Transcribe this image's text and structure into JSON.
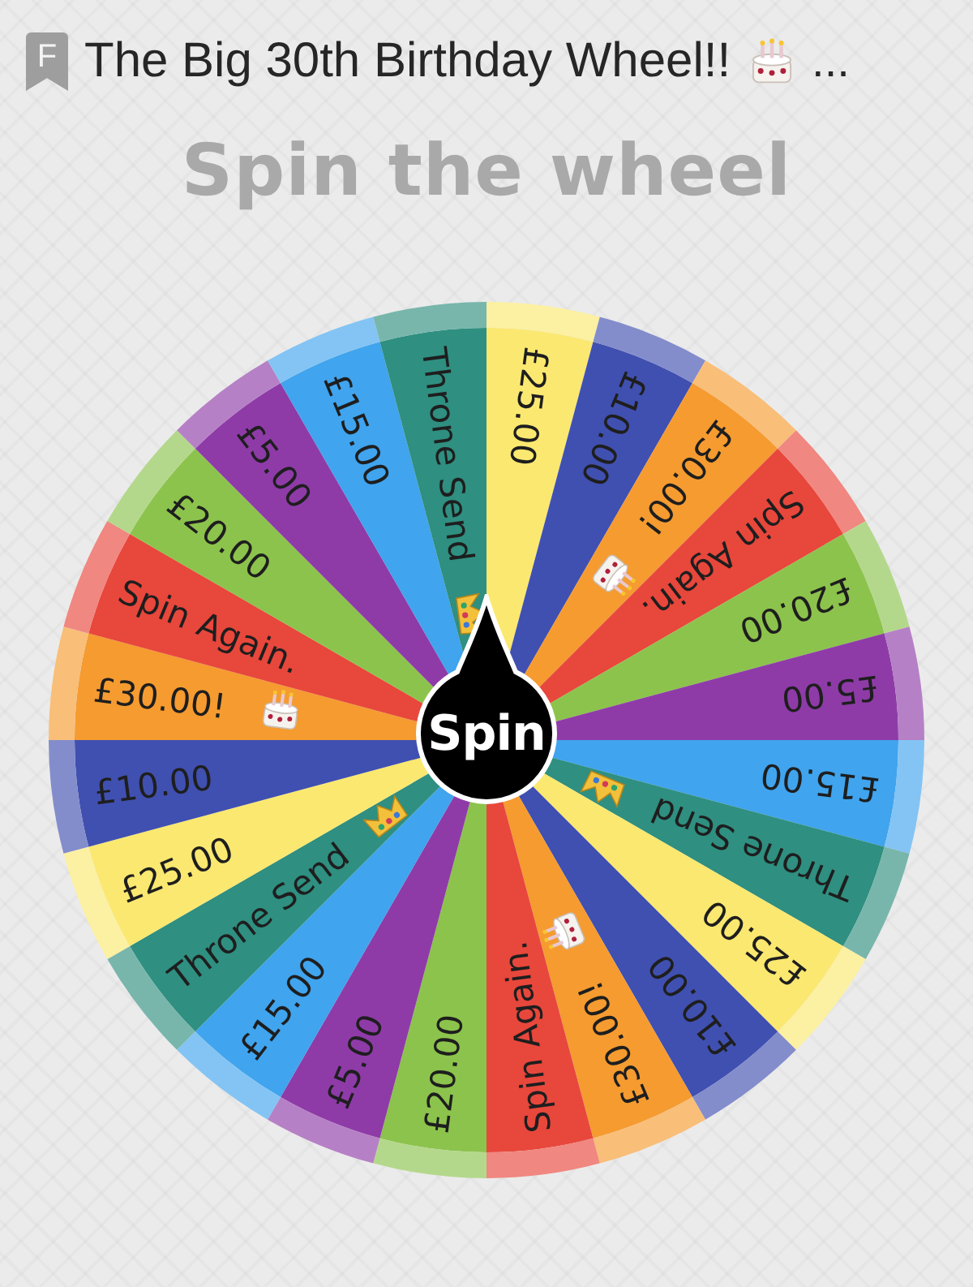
{
  "header": {
    "badge": "F",
    "title": "The Big 30th Birthday Wheel!!",
    "ellipsis": "..."
  },
  "heading": "Spin the wheel",
  "wheel": {
    "button": "Spin",
    "segments": [
      {
        "label": "£25.00",
        "color": "#fbe870",
        "kind": "plain"
      },
      {
        "label": "£10.00",
        "color": "#4050b0",
        "kind": "plain"
      },
      {
        "label": "£30.00!",
        "color": "#f59b30",
        "kind": "cake"
      },
      {
        "label": "Spin Again.",
        "color": "#e8473c",
        "kind": "plain"
      },
      {
        "label": "£20.00",
        "color": "#8cc34c",
        "kind": "plain"
      },
      {
        "label": "£5.00",
        "color": "#8e3ba8",
        "kind": "plain"
      },
      {
        "label": "£15.00",
        "color": "#40a4ee",
        "kind": "plain"
      },
      {
        "label": "Throne Send",
        "color": "#2f8f80",
        "kind": "crown"
      },
      {
        "label": "£25.00",
        "color": "#fbe870",
        "kind": "plain"
      },
      {
        "label": "£10.00",
        "color": "#4050b0",
        "kind": "plain"
      },
      {
        "label": "£30.00!",
        "color": "#f59b30",
        "kind": "cake"
      },
      {
        "label": "Spin Again.",
        "color": "#e8473c",
        "kind": "plain"
      },
      {
        "label": "£20.00",
        "color": "#8cc34c",
        "kind": "plain"
      },
      {
        "label": "£5.00",
        "color": "#8e3ba8",
        "kind": "plain"
      },
      {
        "label": "£15.00",
        "color": "#40a4ee",
        "kind": "plain"
      },
      {
        "label": "Throne Send",
        "color": "#2f8f80",
        "kind": "crown"
      },
      {
        "label": "£25.00",
        "color": "#fbe870",
        "kind": "plain"
      },
      {
        "label": "£10.00",
        "color": "#4050b0",
        "kind": "plain"
      },
      {
        "label": "£30.00!",
        "color": "#f59b30",
        "kind": "cake"
      },
      {
        "label": "Spin Again.",
        "color": "#e8473c",
        "kind": "plain"
      },
      {
        "label": "£20.00",
        "color": "#8cc34c",
        "kind": "plain"
      },
      {
        "label": "£5.00",
        "color": "#8e3ba8",
        "kind": "plain"
      },
      {
        "label": "£15.00",
        "color": "#40a4ee",
        "kind": "plain"
      },
      {
        "label": "Throne Send",
        "color": "#2f8f80",
        "kind": "crown"
      }
    ]
  }
}
